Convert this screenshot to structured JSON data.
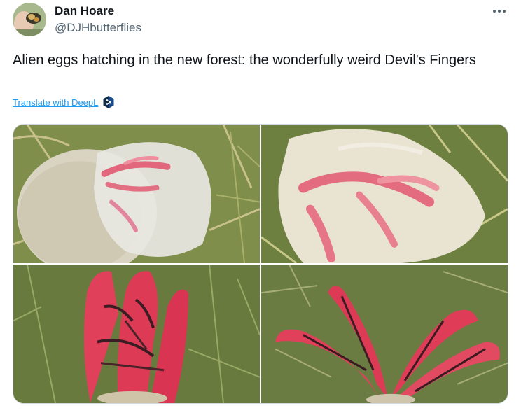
{
  "tweet": {
    "author": {
      "display_name": "Dan Hoare",
      "handle": "@DJHbutterflies",
      "avatar_icon": "butterfly-avatar"
    },
    "more_icon": "more-horizontal-icon",
    "text": "Alien eggs hatching in the new forest: the wonderfully weird Devil's Fingers",
    "translate": {
      "label": "Translate with DeepL",
      "icon": "deepl-icon"
    },
    "media": [
      {
        "subject": "egg-with-pink-arms-inside"
      },
      {
        "subject": "translucent-egg-pink-arms"
      },
      {
        "subject": "red-fingers-closed"
      },
      {
        "subject": "red-fingers-spread"
      }
    ]
  },
  "colors": {
    "text_primary": "#0f1419",
    "text_secondary": "#536471",
    "link": "#1d9bf0",
    "border": "#cfd9de",
    "fungus_red": "#e0405a"
  }
}
